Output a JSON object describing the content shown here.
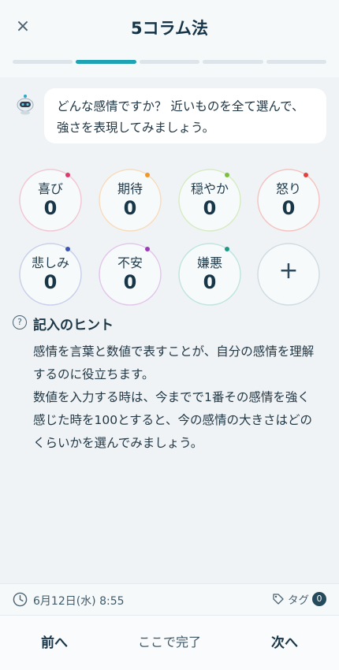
{
  "header": {
    "close_glyph": "×",
    "title": "5コラム法",
    "progress": {
      "total_steps": 5,
      "current_step": 2
    }
  },
  "assistant": {
    "message": "どんな感情ですか？ 近いものを全て選んで、強さを表現してみましょう。"
  },
  "emotions": [
    {
      "label": "喜び",
      "value": "0",
      "color": "#e0396e"
    },
    {
      "label": "期待",
      "value": "0",
      "color": "#f2962a"
    },
    {
      "label": "穏やか",
      "value": "0",
      "color": "#7cbf3f"
    },
    {
      "label": "怒り",
      "value": "0",
      "color": "#e2403a"
    },
    {
      "label": "悲しみ",
      "value": "0",
      "color": "#3d54b3"
    },
    {
      "label": "不安",
      "value": "0",
      "color": "#9d3cb8"
    },
    {
      "label": "嫌悪",
      "value": "0",
      "color": "#1c9a86"
    }
  ],
  "add_emotion": {
    "glyph": "+"
  },
  "hint": {
    "icon_glyph": "?",
    "title": "記入のヒント",
    "paragraph1": "感情を言葉と数値で表すことが、自分の感情を理解するのに役立ちます。",
    "paragraph2": "数値を入力する時は、今までで1番その感情を強く感じた時を100とすると、今の感情の大きさはどのくらいかを選んでみましょう。"
  },
  "meta": {
    "date": "6月12日(水) 8:55",
    "tag_label": "タグ",
    "tag_count": "0"
  },
  "footer": {
    "prev": "前へ",
    "done": "ここで完了",
    "next": "次へ"
  }
}
